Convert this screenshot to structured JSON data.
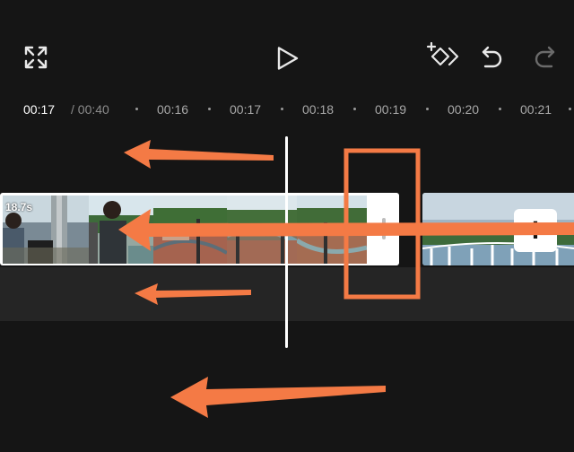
{
  "toolbar": {
    "fullscreen_icon": "fullscreen-expand-icon",
    "play_icon": "play-icon",
    "keyframe_icon": "add-keyframe-icon",
    "undo_icon": "undo-icon",
    "redo_icon": "redo-icon"
  },
  "timeline": {
    "current_time": "00:17",
    "total_time": "/ 00:40",
    "ticks": [
      "00:16",
      "00:17",
      "00:18",
      "00:19",
      "00:20",
      "00:21"
    ]
  },
  "clip": {
    "duration_label": "18.7s"
  },
  "add_button": {
    "label": "+"
  },
  "colors": {
    "background": "#151515",
    "band": "#252525",
    "annotation": "#f47a45",
    "muted_text": "#8c8c8c"
  }
}
